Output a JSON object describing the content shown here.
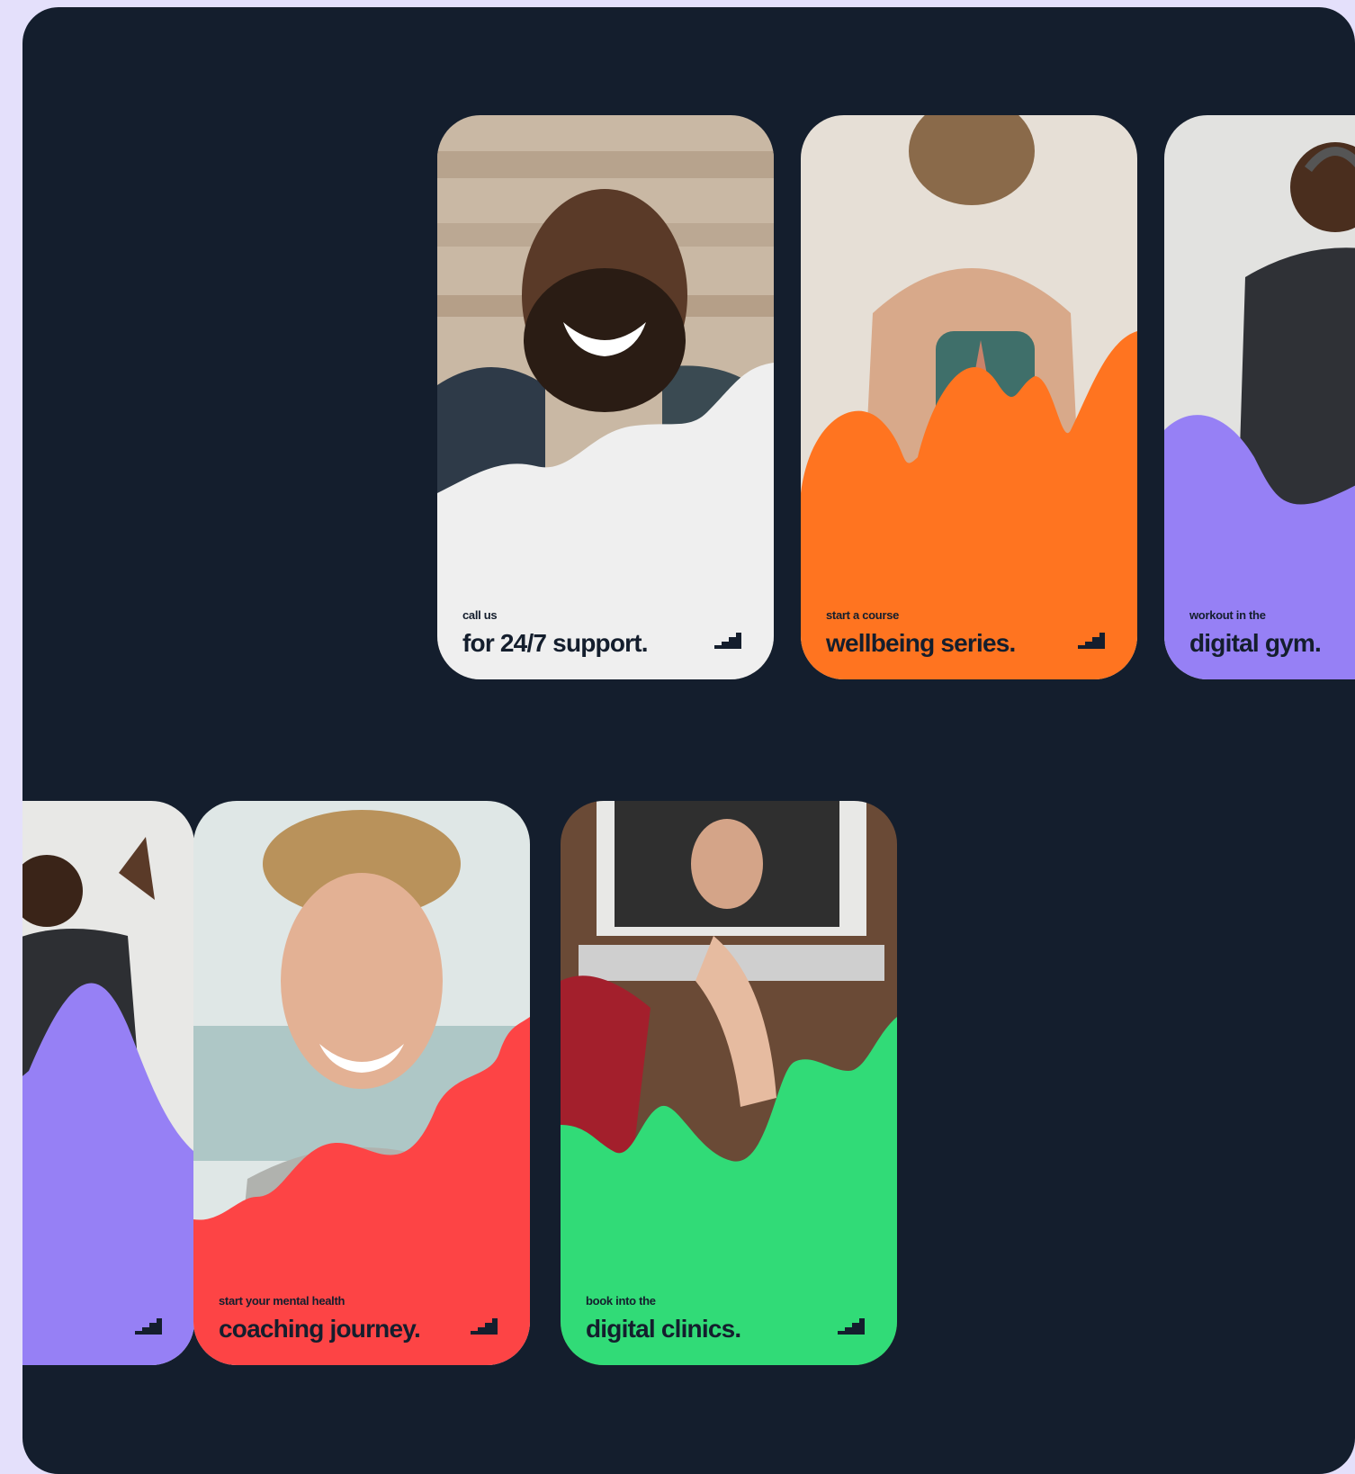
{
  "cards": [
    {
      "id": "support",
      "eyebrow": "call us",
      "headline": "for 24/7 support.",
      "color": "#efefef"
    },
    {
      "id": "wellbeing",
      "eyebrow": "start a course",
      "headline": "wellbeing series.",
      "color": "#ff7420"
    },
    {
      "id": "gym",
      "eyebrow": "workout in the",
      "headline": "digital gym.",
      "color": "#9680f5"
    },
    {
      "id": "gym2",
      "eyebrow": "",
      "headline": "",
      "color": "#9680f5"
    },
    {
      "id": "coaching",
      "eyebrow": "start your mental health",
      "headline": "coaching journey.",
      "color": "#fd4445"
    },
    {
      "id": "clinics",
      "eyebrow": "book into the",
      "headline": "digital clinics.",
      "color": "#31db77"
    }
  ],
  "colors": {
    "background": "#141e2d",
    "page": "#e4e0fb",
    "text": "#141e2d"
  },
  "icons": {
    "card_logo": "stairs-logo-icon"
  }
}
